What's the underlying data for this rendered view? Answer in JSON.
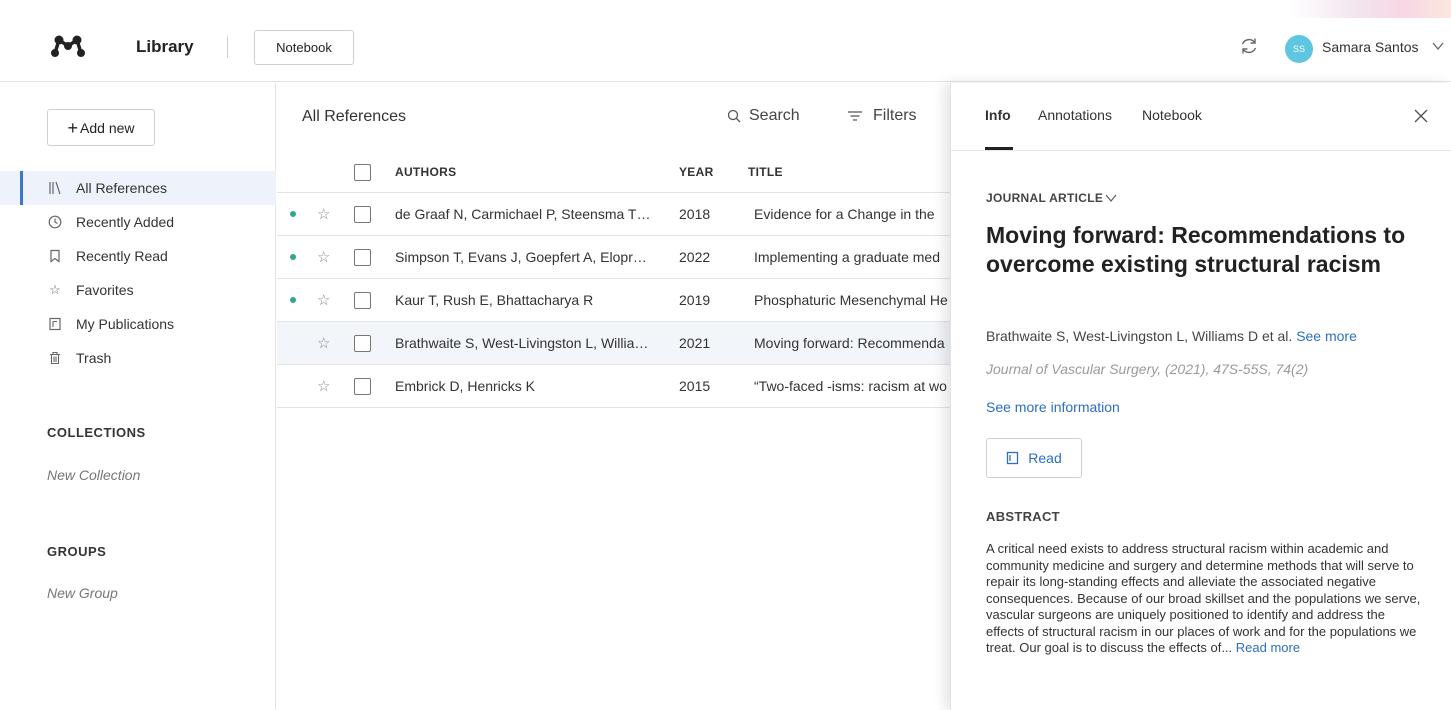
{
  "header": {
    "app_title": "Library",
    "notebook_label": "Notebook",
    "user_initials": "SS",
    "user_name": "Samara Santos"
  },
  "sidebar": {
    "add_new_label": "Add new",
    "nav": [
      {
        "label": "All References",
        "icon": "library-icon",
        "active": true
      },
      {
        "label": "Recently Added",
        "icon": "clock-icon"
      },
      {
        "label": "Recently Read",
        "icon": "bookmark-icon"
      },
      {
        "label": "Favorites",
        "icon": "star-icon"
      },
      {
        "label": "My Publications",
        "icon": "publication-icon"
      },
      {
        "label": "Trash",
        "icon": "trash-icon"
      }
    ],
    "collections_heading": "COLLECTIONS",
    "new_collection": "New Collection",
    "groups_heading": "GROUPS",
    "new_group": "New Group"
  },
  "main": {
    "title": "All References",
    "search_label": "Search",
    "filters_label": "Filters",
    "columns": {
      "authors": "AUTHORS",
      "year": "YEAR",
      "title": "TITLE"
    },
    "rows": [
      {
        "unread": true,
        "authors": "de Graaf N, Carmichael P, Steensma T…",
        "year": "2018",
        "title": "Evidence for a Change in the"
      },
      {
        "unread": true,
        "authors": "Simpson T, Evans J, Goepfert A, Elopr…",
        "year": "2022",
        "title": "Implementing a graduate med"
      },
      {
        "unread": true,
        "authors": "Kaur T, Rush E, Bhattacharya R",
        "year": "2019",
        "title": "Phosphaturic Mesenchymal He"
      },
      {
        "unread": false,
        "selected": true,
        "authors": "Brathwaite S, West-Livingston L, Willia…",
        "year": "2021",
        "title": "Moving forward: Recommenda"
      },
      {
        "unread": false,
        "authors": "Embrick D, Henricks K",
        "year": "2015",
        "title": "“Two-faced -isms: racism at wo"
      }
    ]
  },
  "panel": {
    "tabs": {
      "info": "Info",
      "annotations": "Annotations",
      "notebook": "Notebook"
    },
    "type": "JOURNAL ARTICLE",
    "title": "Moving forward: Recommendations to overcome existing structural racism",
    "authors": "Brathwaite S, West-Livingston L, Williams D et al.",
    "see_more": "See more",
    "journal": "Journal of Vascular Surgery, (2021), 47S-55S, 74(2)",
    "more_info": "See more information",
    "read_label": "Read",
    "abstract_heading": "ABSTRACT",
    "abstract": "A critical need exists to address structural racism within academic and community medicine and surgery and determine methods that will serve to repair its long-standing effects and alleviate the associated negative consequences. Because of our broad skillset and the populations we serve, vascular surgeons are uniquely positioned to identify and address the effects of structural racism in our places of work and for the populations we treat. Our goal is to discuss the effects of...",
    "read_more": "Read more"
  },
  "colors": {
    "accent": "#2c6fbf",
    "unread_dot": "#2ea98f",
    "avatar": "#5ec6e0",
    "active_bar": "#3a78c8"
  }
}
